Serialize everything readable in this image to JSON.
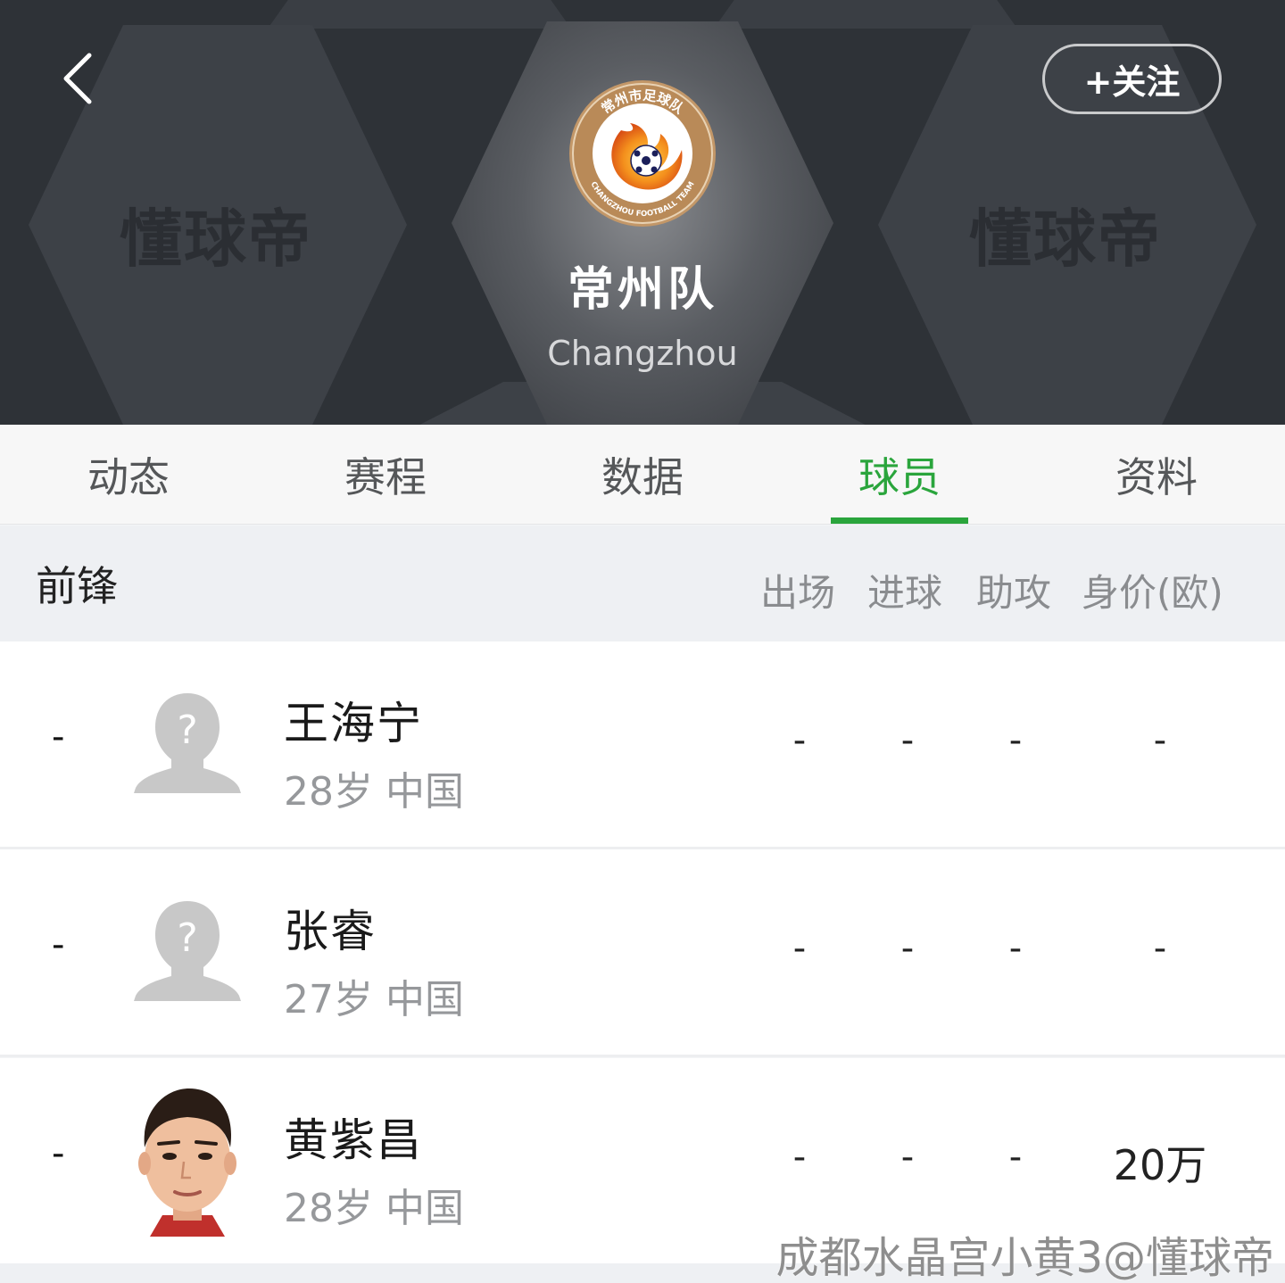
{
  "header": {
    "watermark_left": "懂球帝",
    "watermark_right": "懂球帝",
    "follow_label": "+关注",
    "team_name": "常州队",
    "team_name_en": "Changzhou",
    "badge": {
      "top_text": "常州市足球队",
      "bottom_text": "CHANGZHOU FOOTBALL TEAM",
      "colors": {
        "ring": "#c49a6c",
        "inner": "#ffffff",
        "flame": "#f08c1e",
        "ball": "#1b1f5a"
      }
    }
  },
  "tabs": [
    {
      "label": "动态",
      "active": false
    },
    {
      "label": "赛程",
      "active": false
    },
    {
      "label": "数据",
      "active": false
    },
    {
      "label": "球员",
      "active": true
    },
    {
      "label": "资料",
      "active": false
    }
  ],
  "accent_color": "#2aa53c",
  "section": {
    "title": "前锋",
    "columns": [
      "出场",
      "进球",
      "助攻",
      "身价(欧)"
    ]
  },
  "players": [
    {
      "number": "-",
      "name": "王海宁",
      "info": "28岁 中国",
      "avatar": "placeholder-avatar",
      "apps": "-",
      "goals": "-",
      "assists": "-",
      "value": "-"
    },
    {
      "number": "-",
      "name": "张睿",
      "info": "27岁 中国",
      "avatar": "placeholder-avatar",
      "apps": "-",
      "goals": "-",
      "assists": "-",
      "value": "-"
    },
    {
      "number": "-",
      "name": "黄紫昌",
      "info": "28岁 中国",
      "avatar": "player-photo",
      "apps": "-",
      "goals": "-",
      "assists": "-",
      "value": "20万"
    }
  ],
  "source_watermark": "成都水晶宫小黄3@懂球帝"
}
